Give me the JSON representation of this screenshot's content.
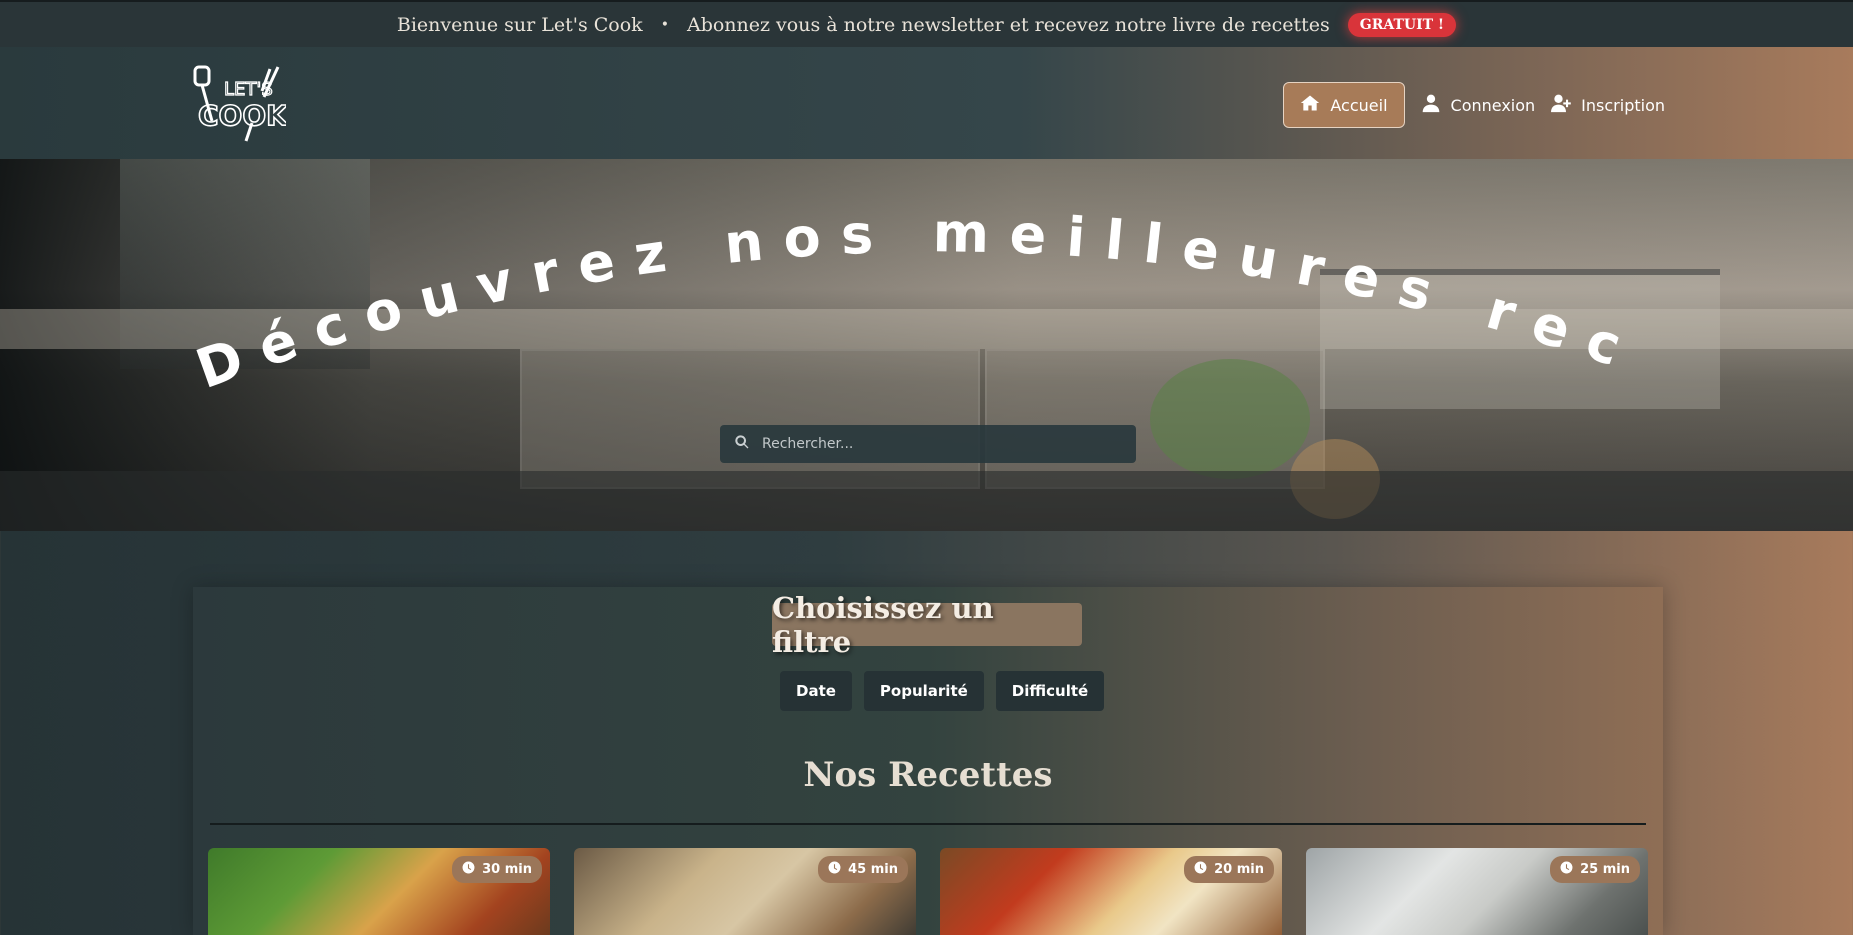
{
  "announcement": {
    "welcome": "Bienvenue sur Let's Cook",
    "separator": "•",
    "newsletter": "Abonnez vous à notre newsletter et recevez notre livre de recettes",
    "badge": "GRATUIT !"
  },
  "header": {
    "logo_text_top": "LET'S",
    "logo_text_bottom": "COOK",
    "nav": [
      {
        "label": "Accueil",
        "icon": "home-icon",
        "active": true
      },
      {
        "label": "Connexion",
        "icon": "user-icon",
        "active": false
      },
      {
        "label": "Inscription",
        "icon": "user-plus-icon",
        "active": false
      }
    ]
  },
  "hero": {
    "title": "Découvrez nos meilleures recettes",
    "search_placeholder": "Rechercher..."
  },
  "filters": {
    "title": "Choisissez un filtre",
    "buttons": [
      "Date",
      "Popularité",
      "Difficulté"
    ]
  },
  "recipes": {
    "title": "Nos Recettes",
    "cards": [
      {
        "time": "30 min",
        "image": "burger"
      },
      {
        "time": "45 min",
        "image": "tacos"
      },
      {
        "time": "20 min",
        "image": "pizza"
      },
      {
        "time": "25 min",
        "image": "bowls"
      }
    ]
  },
  "colors": {
    "accent": "#a77b58",
    "badge_red": "#d9343a",
    "dark": "#263235"
  }
}
